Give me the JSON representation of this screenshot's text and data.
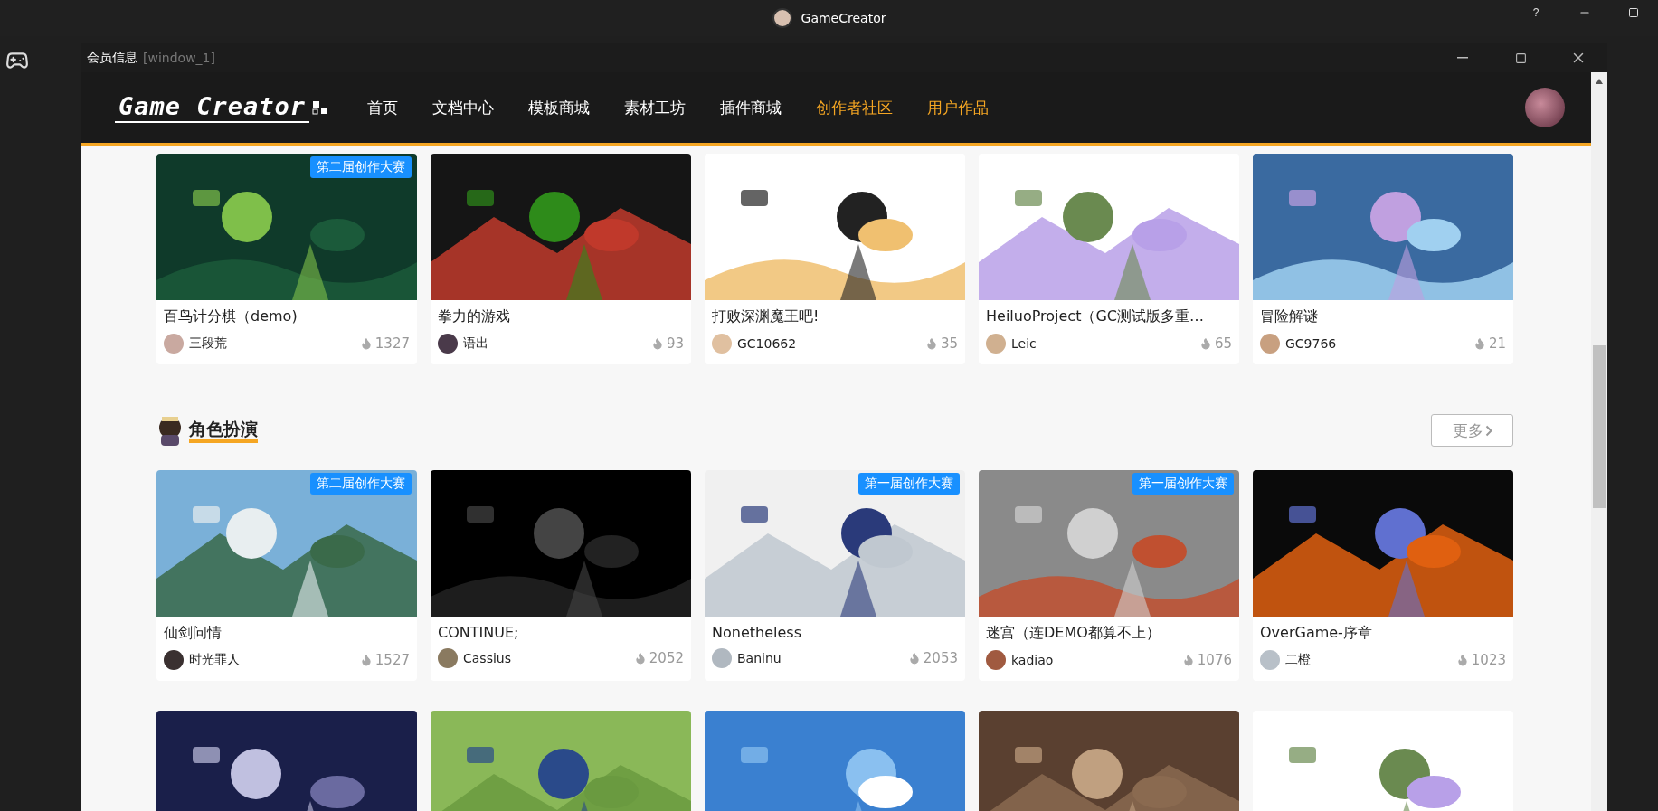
{
  "app_title": "GameCreator",
  "outer_controls": [
    "?"
  ],
  "window": {
    "title": "会员信息",
    "subtitle": "[window_1]"
  },
  "logo": "Game Creator",
  "nav": [
    {
      "label": "首页",
      "highlighted": false
    },
    {
      "label": "文档中心",
      "highlighted": false
    },
    {
      "label": "模板商城",
      "highlighted": false
    },
    {
      "label": "素材工坊",
      "highlighted": false
    },
    {
      "label": "插件商城",
      "highlighted": false
    },
    {
      "label": "创作者社区",
      "highlighted": true
    },
    {
      "label": "用户作品",
      "highlighted": true
    }
  ],
  "sections": [
    {
      "cards": [
        {
          "kind": "game",
          "badge": "第二届创作大赛",
          "title": "百鸟计分棋（demo)",
          "author": "三段荒",
          "heat": "1327"
        },
        {
          "kind": "game",
          "title": "拳力的游戏",
          "author": "语出",
          "heat": "93"
        },
        {
          "kind": "game",
          "title": "打败深渊魔王吧!",
          "author": "GC10662",
          "heat": "35"
        },
        {
          "kind": "game",
          "title": "HeiluoProject（GC测试版多重…",
          "author": "Leic",
          "heat": "65"
        },
        {
          "kind": "game",
          "title": "冒险解谜",
          "author": "GC9766",
          "heat": "21"
        }
      ]
    },
    {
      "title": "角色扮演",
      "more": "更多",
      "cards": [
        {
          "kind": "game",
          "badge": "第二届创作大赛",
          "title": "仙剑问情",
          "author": "时光罪人",
          "heat": "1527"
        },
        {
          "kind": "game",
          "title": "CONTINUE;",
          "author": "Cassius",
          "heat": "2052"
        },
        {
          "kind": "game",
          "badge": "第一届创作大赛",
          "title": "Nonetheless",
          "author": "Baninu",
          "heat": "2053"
        },
        {
          "kind": "game",
          "badge": "第一届创作大赛",
          "title": "迷宫（连DEMO都算不上）",
          "author": "kadiao",
          "heat": "1076"
        },
        {
          "kind": "game",
          "title": "OverGame-序章",
          "author": "二橙",
          "heat": "1023"
        },
        {
          "kind": "picture"
        },
        {
          "kind": "picture"
        },
        {
          "kind": "picture"
        },
        {
          "kind": "picture"
        },
        {
          "kind": "picture"
        }
      ]
    }
  ]
}
